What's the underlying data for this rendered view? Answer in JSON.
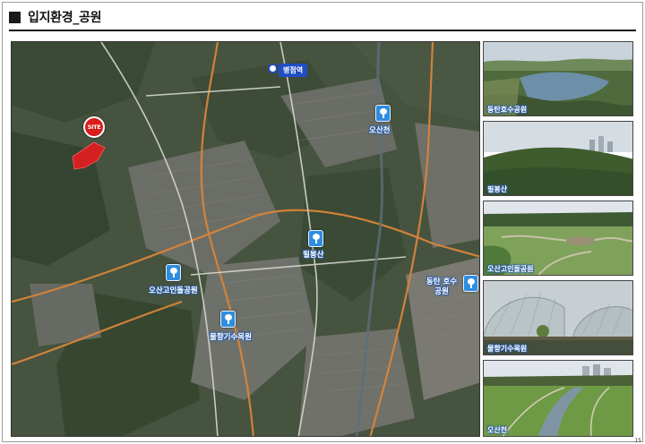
{
  "header": {
    "title": "입지환경_공원"
  },
  "map": {
    "site_label": "SITE",
    "station_label": "병점역",
    "parks": [
      {
        "name": "오산천"
      },
      {
        "name": "필봉산"
      },
      {
        "name": "오산고인돌공원"
      },
      {
        "name": "물향기수목원"
      },
      {
        "name": "동탄 호수공원"
      }
    ],
    "colors": {
      "park_pin": "#2f8de0",
      "station": "#1f4ec4",
      "site": "#d91c1c",
      "site_area": "#d42020",
      "road": "#d8853a"
    }
  },
  "photos": [
    {
      "caption": "동탄호수공원"
    },
    {
      "caption": "필봉산"
    },
    {
      "caption": "오산고인돌공원"
    },
    {
      "caption": "물향기수목원"
    },
    {
      "caption": "오산천"
    }
  ],
  "page_number": "15"
}
